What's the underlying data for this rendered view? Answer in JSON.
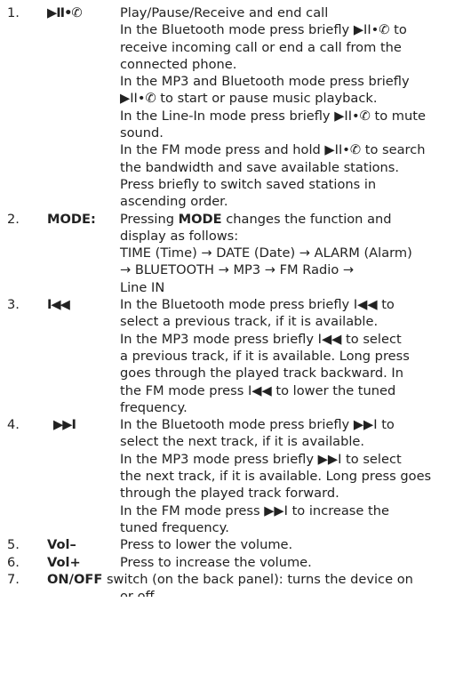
{
  "items": [
    {
      "num": "1.",
      "key": "▶II•✆",
      "lines": [
        "Play/Pause/Receive and end call",
        "In the Bluetooth mode press briefly ▶II•✆ to",
        "receive incoming call or end a call from the",
        "connected phone.",
        "In the MP3 and Bluetooth mode press briefly",
        "▶II•✆ to start or pause music playback.",
        "In the Line-In mode press briefly ▶II•✆ to mute",
        "sound.",
        "In the FM mode press and hold ▶II•✆ to search",
        "the bandwidth and save available stations.",
        "Press briefly to switch saved stations in",
        "ascending order."
      ]
    },
    {
      "num": "2.",
      "key": "MODE:",
      "lines": [
        "Pressing MODE changes the function and",
        "display as follows:",
        "TIME (Time) → DATE (Date) → ALARM (Alarm)",
        "→ BLUETOOTH → MP3 → FM Radio →",
        "Line IN"
      ]
    },
    {
      "num": "3.",
      "key": "I◀◀",
      "lines": [
        "In the Bluetooth mode press briefly I◀◀ to",
        "select a previous track, if it is available.",
        "In the MP3 mode press briefly I◀◀ to select",
        "a previous track, if it is available. Long press",
        "goes through the played track backward. In",
        "the FM mode press I◀◀ to lower the tuned",
        "frequency."
      ]
    },
    {
      "num": "4.",
      "key": "▶▶I",
      "lines": [
        "In the Bluetooth mode press briefly ▶▶I to",
        "select the next track, if it is available.",
        "In the MP3 mode press briefly ▶▶I to select",
        "the next track, if it is available. Long press goes",
        "through the played track forward.",
        "In the FM mode press ▶▶I to increase the",
        "tuned frequency."
      ]
    },
    {
      "num": "5.",
      "key": "Vol–",
      "lines": [
        "Press to lower the volume."
      ]
    },
    {
      "num": "6.",
      "key": "Vol+",
      "lines": [
        "Press to increase the volume."
      ]
    }
  ],
  "item7": {
    "num": "7.",
    "key": "ON/OFF",
    "text": "switch (on the back panel): turns the device on",
    "cont": "or off"
  }
}
